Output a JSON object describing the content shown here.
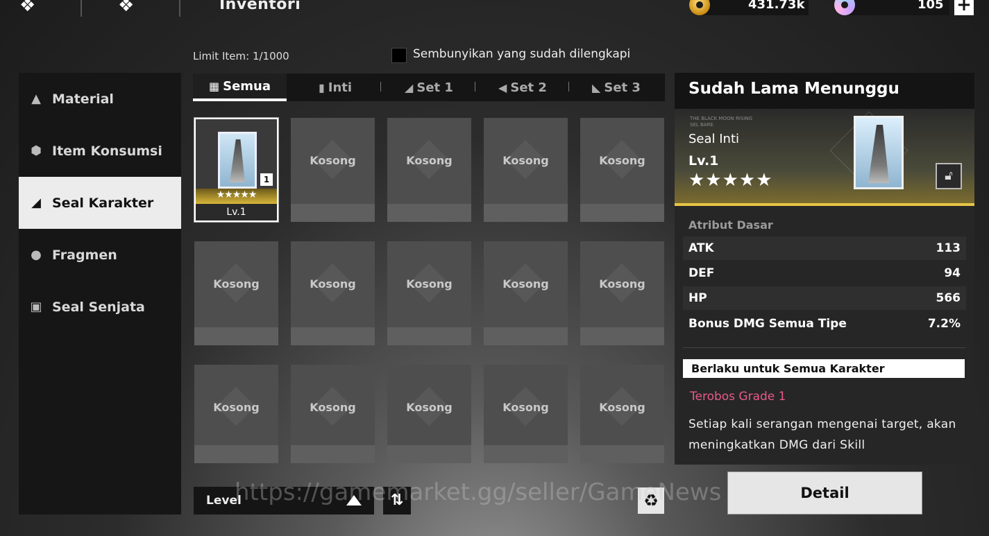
{
  "header": {
    "title": "Inventori",
    "gold_value": "431.73k",
    "gem_value": "105",
    "plus_label": "+"
  },
  "limit": {
    "label": "Limit Item:",
    "value": "1/1000"
  },
  "hide_equipped": {
    "label": "Sembunyikan yang sudah dilengkapi",
    "checked": false
  },
  "sidebar": {
    "items": [
      {
        "label": "Material",
        "icon": "material-icon"
      },
      {
        "label": "Item Konsumsi",
        "icon": "consumable-icon"
      },
      {
        "label": "Seal Karakter",
        "icon": "seal-icon",
        "active": true
      },
      {
        "label": "Fragmen",
        "icon": "fragment-icon"
      },
      {
        "label": "Seal Senjata",
        "icon": "weapon-seal-icon"
      }
    ]
  },
  "tabs": [
    {
      "label": "Semua",
      "icon": "grid-icon",
      "active": true
    },
    {
      "label": "Inti",
      "icon": "core-icon"
    },
    {
      "label": "Set 1",
      "icon": "set1-icon"
    },
    {
      "label": "Set 2",
      "icon": "set2-icon"
    },
    {
      "label": "Set 3",
      "icon": "set3-icon"
    }
  ],
  "grid": {
    "filled_item": {
      "stars": "★★★★★",
      "qty": "1",
      "level": "Lv.1"
    },
    "empty_label": "Kosong"
  },
  "sort": {
    "label": "Level"
  },
  "watermark": "https://gamemarket.gg/seller/GameNews",
  "panel": {
    "title": "Sudah Lama Menunggu",
    "tiny_text_1": "THE BLACK MOON RISING",
    "tiny_text_2": "SEL BARE",
    "type": "Seal Inti",
    "level": "Lv.1",
    "stars": "★★★★★",
    "attr_heading": "Atribut Dasar",
    "attributes": [
      {
        "name": "ATK",
        "value": "113"
      },
      {
        "name": "DEF",
        "value": "94"
      },
      {
        "name": "HP",
        "value": "566"
      },
      {
        "name": "Bonus DMG Semua Tipe",
        "value": "7.2%"
      }
    ],
    "apply_banner": "Berlaku untuk Semua Karakter",
    "grade": "Terobos Grade 1",
    "description": "Setiap kali serangan mengenai target, akan meningkatkan DMG dari Skill"
  },
  "detail_button": "Detail",
  "colors": {
    "accent_gold": "#e8c547",
    "grade_pink": "#e85a8a",
    "active_tab_bg": "#ececec"
  }
}
